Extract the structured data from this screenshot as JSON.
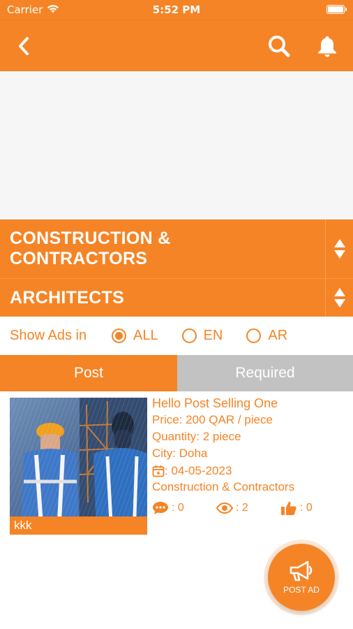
{
  "status_bar": {
    "carrier": "Carrier",
    "time": "5:52 PM"
  },
  "nav": {
    "back_icon": "chevron-left-icon",
    "search_icon": "search-icon",
    "notification_icon": "bell-icon"
  },
  "categories": {
    "primary": "CONSTRUCTION & CONTRACTORS",
    "secondary": "ARCHITECTS"
  },
  "language_filter": {
    "label": "Show Ads in",
    "options": [
      "ALL",
      "EN",
      "AR"
    ],
    "selected": "ALL"
  },
  "tabs": [
    {
      "label": "Post",
      "active": true
    },
    {
      "label": "Required",
      "active": false
    }
  ],
  "listings": [
    {
      "thumb_caption": "kkk",
      "title": "Hello Post Selling One",
      "price": "Price: 200 QAR / piece",
      "quantity": "Quantity: 2 piece",
      "city": "City: Doha",
      "date": ": 04-05-2023",
      "category": "Construction & Contractors",
      "comments": ": 0",
      "views": ": 2",
      "likes": ": 0"
    }
  ],
  "fab": {
    "label": "POST AD",
    "icon": "megaphone-icon"
  },
  "colors": {
    "accent": "#f58426",
    "inactive_tab": "#c2c2c2",
    "banner_bg": "#f6f6f6"
  }
}
